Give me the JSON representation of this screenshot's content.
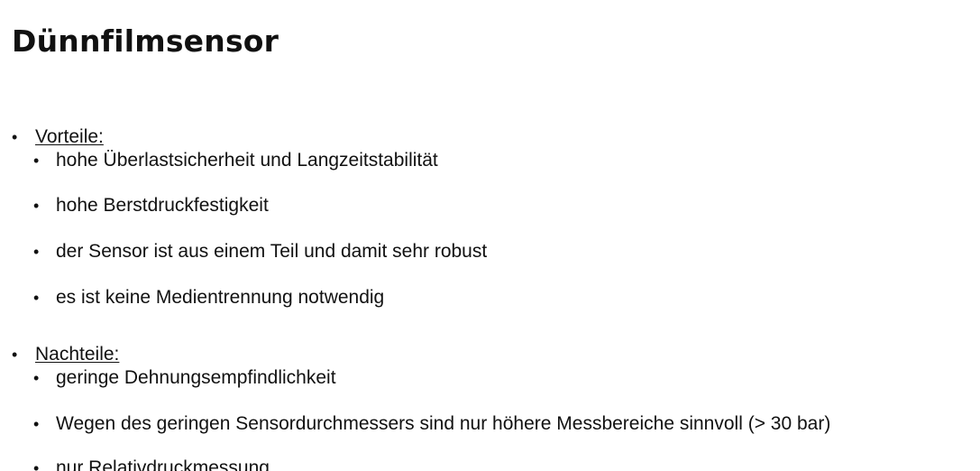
{
  "title": "Dünnfilmsensor",
  "sections": [
    {
      "heading": "Vorteile:",
      "items": [
        "hohe Überlastsicherheit und Langzeitstabilität",
        "hohe Berstdruckfestigkeit",
        "der Sensor ist aus einem Teil und damit sehr robust",
        "es ist keine Medientrennung notwendig"
      ]
    },
    {
      "heading": "Nachteile:",
      "items": [
        "geringe Dehnungsempfindlichkeit",
        "Wegen des geringen Sensordurchmessers sind nur höhere Messbereiche sinnvoll (> 30 bar)",
        "nur Relativdruckmessung"
      ]
    }
  ]
}
